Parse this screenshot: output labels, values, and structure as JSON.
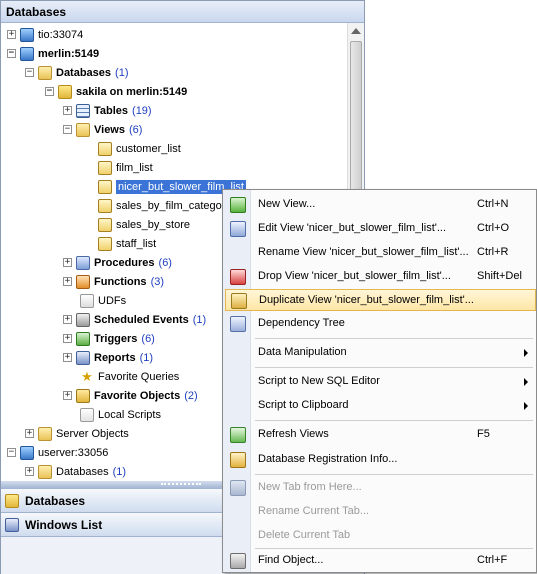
{
  "panel": {
    "title": "Databases"
  },
  "tree": {
    "server1": "tio:33074",
    "server2": "merlin:5149",
    "databases_label": "Databases",
    "databases_count": "(1)",
    "db_label": "sakila on merlin:5149",
    "tables_label": "Tables",
    "tables_count": "(19)",
    "views_label": "Views",
    "views_count": "(6)",
    "views": [
      "customer_list",
      "film_list",
      "nicer_but_slower_film_list",
      "sales_by_film_catego",
      "sales_by_store",
      "staff_list"
    ],
    "procedures_label": "Procedures",
    "procedures_count": "(6)",
    "functions_label": "Functions",
    "functions_count": "(3)",
    "udfs_label": "UDFs",
    "scheduled_label": "Scheduled Events",
    "scheduled_count": "(1)",
    "triggers_label": "Triggers",
    "triggers_count": "(6)",
    "reports_label": "Reports",
    "reports_count": "(1)",
    "favq_label": "Favorite Queries",
    "favo_label": "Favorite Objects",
    "favo_count": "(2)",
    "scripts_label": "Local Scripts",
    "server_objects_label": "Server Objects",
    "server3": "userver:33056",
    "server3_db_label": "Databases",
    "server3_db_count": "(1)"
  },
  "nav": {
    "databases": "Databases",
    "windows_list": "Windows List"
  },
  "menu": {
    "items": [
      {
        "label": "New View...",
        "shortcut": "Ctrl+N"
      },
      {
        "label": "Edit View 'nicer_but_slower_film_list'...",
        "shortcut": "Ctrl+O"
      },
      {
        "label": "Rename View 'nicer_but_slower_film_list'...",
        "shortcut": "Ctrl+R"
      },
      {
        "label": "Drop View 'nicer_but_slower_film_list'...",
        "shortcut": "Shift+Del"
      },
      {
        "label": "Duplicate View 'nicer_but_slower_film_list'...",
        "shortcut": ""
      },
      {
        "label": "Dependency Tree",
        "shortcut": ""
      },
      {
        "label": "Data Manipulation",
        "shortcut": ""
      },
      {
        "label": "Script to New SQL Editor",
        "shortcut": ""
      },
      {
        "label": "Script to Clipboard",
        "shortcut": ""
      },
      {
        "label": "Refresh Views",
        "shortcut": "F5"
      },
      {
        "label": "Database Registration Info...",
        "shortcut": ""
      },
      {
        "label": "New Tab from Here...",
        "shortcut": ""
      },
      {
        "label": "Rename Current Tab...",
        "shortcut": ""
      },
      {
        "label": "Delete Current Tab",
        "shortcut": ""
      },
      {
        "label": "Find Object...",
        "shortcut": "Ctrl+F"
      }
    ]
  },
  "colors": {
    "selection": "#3b73d6",
    "menu_highlight": "#ffe6a6",
    "count_text": "#1f3fbf"
  }
}
